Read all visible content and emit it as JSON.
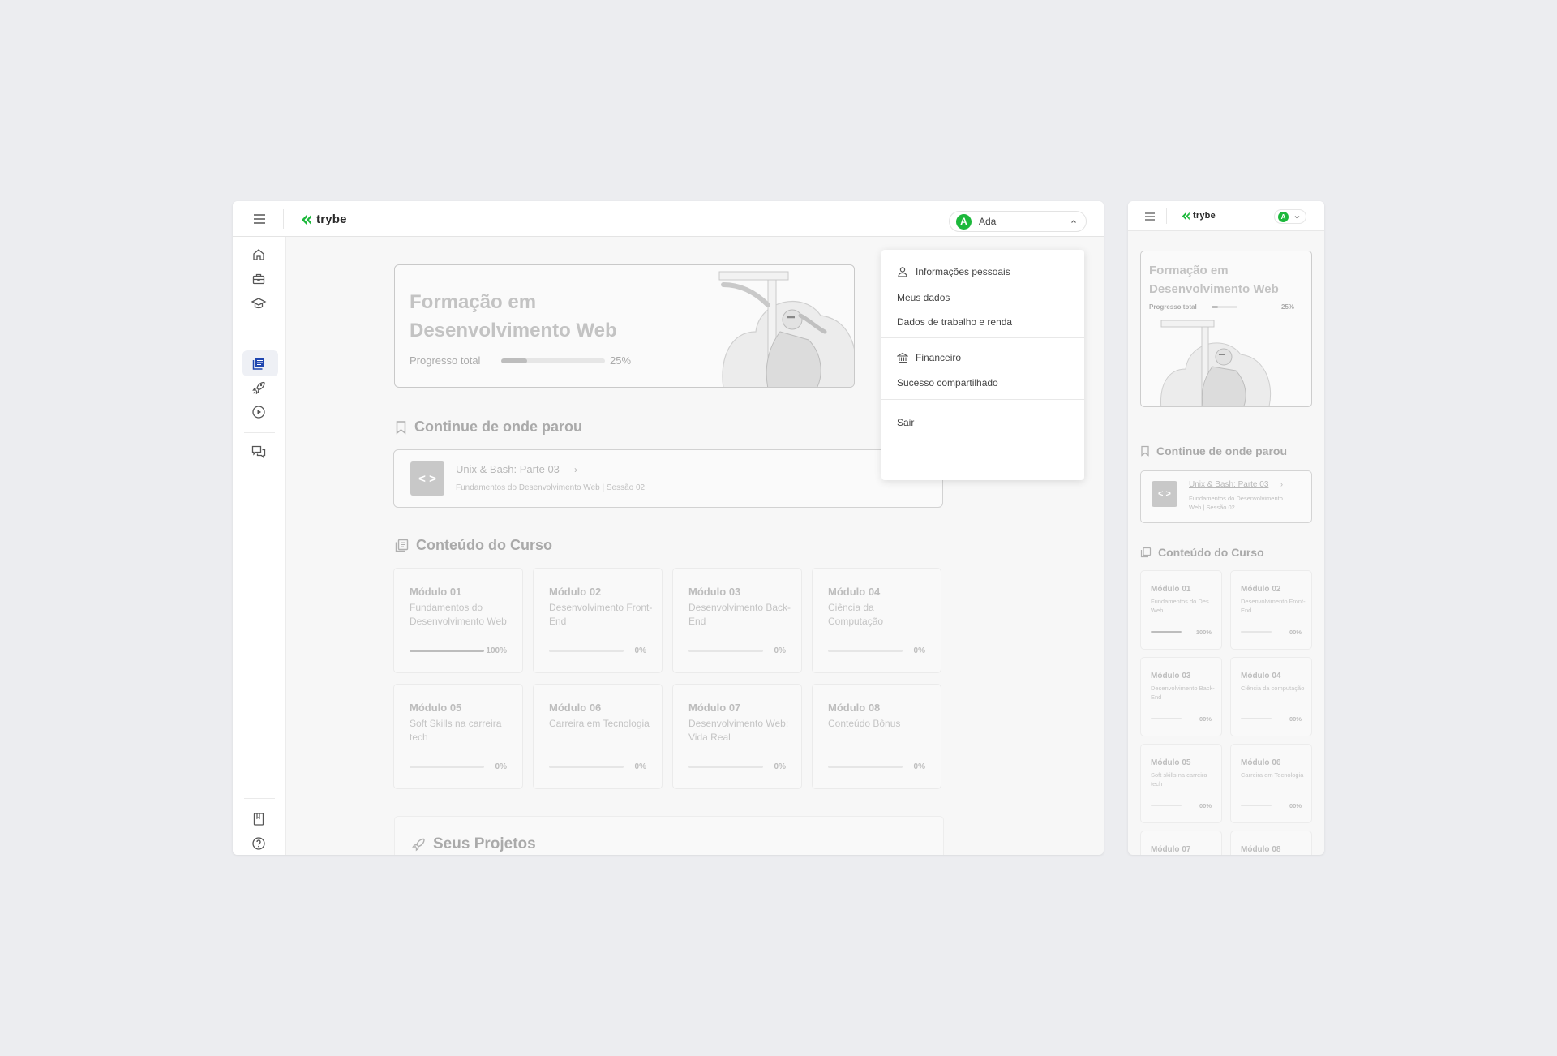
{
  "brand": {
    "name": "trybe",
    "accent": "#1cb83b"
  },
  "user": {
    "initial": "A",
    "name": "Ada"
  },
  "hero": {
    "title": "Formação em Desenvolvimento Web",
    "progress_label": "Progresso total",
    "progress_pct": "25%",
    "progress_value": 0.25
  },
  "continue": {
    "heading": "Continue de onde parou",
    "lesson": "Unix & Bash:  Parte 03",
    "subtitle": "Fundamentos do Desenvolvimento Web | Sessão 02",
    "code_glyph": "< >"
  },
  "content": {
    "heading": "Conteúdo do Curso",
    "modules": [
      {
        "name": "Módulo 01",
        "desc": "Fundamentos do Desenvolvimento Web",
        "pct": "100%",
        "value": 1.0
      },
      {
        "name": "Módulo 02",
        "desc": "Desenvolvimento Front-End",
        "pct": "0%",
        "value": 0
      },
      {
        "name": "Módulo 03",
        "desc": "Desenvolvimento Back-End",
        "pct": "0%",
        "value": 0
      },
      {
        "name": "Módulo 04",
        "desc": "Ciência da Computação",
        "pct": "0%",
        "value": 0
      },
      {
        "name": "Módulo 05",
        "desc": "Soft Skills na carreira tech",
        "pct": "0%",
        "value": 0
      },
      {
        "name": "Módulo 06",
        "desc": "Carreira em Tecnologia",
        "pct": "0%",
        "value": 0
      },
      {
        "name": "Módulo 07",
        "desc": "Desenvolvimento Web: Vida Real",
        "pct": "0%",
        "value": 0
      },
      {
        "name": "Módulo 08",
        "desc": "Conteúdo Bônus",
        "pct": "0%",
        "value": 0
      }
    ]
  },
  "projects": {
    "heading": "Seus Projetos"
  },
  "menu": {
    "personal_info": "Informações pessoais",
    "my_data": "Meus dados",
    "work_income": "Dados de trabalho e renda",
    "financial": "Financeiro",
    "shared_success": "Sucesso compartilhado",
    "logout": "Sair"
  },
  "mobile": {
    "continue_subtitle": "Fundamentos do Desenvolvimento Web | Sessão 02",
    "modules": [
      {
        "name": "Módulo 01",
        "desc": "Fundamentos do Des. Web",
        "pct": "100%",
        "value": 1.0
      },
      {
        "name": "Módulo 02",
        "desc": "Desenvolvimento Front-End",
        "pct": "00%",
        "value": 0
      },
      {
        "name": "Módulo 03",
        "desc": "Desenvolvimento Back-End",
        "pct": "00%",
        "value": 0
      },
      {
        "name": "Módulo 04",
        "desc": "Ciência da computação",
        "pct": "00%",
        "value": 0
      },
      {
        "name": "Módulo 05",
        "desc": "Soft skills na carreira tech",
        "pct": "00%",
        "value": 0
      },
      {
        "name": "Módulo 06",
        "desc": "Carreira em Tecnologia",
        "pct": "00%",
        "value": 0
      },
      {
        "name": "Módulo 07",
        "desc": "",
        "pct": "",
        "value": 0
      },
      {
        "name": "Módulo 08",
        "desc": "",
        "pct": "",
        "value": 0
      }
    ]
  }
}
